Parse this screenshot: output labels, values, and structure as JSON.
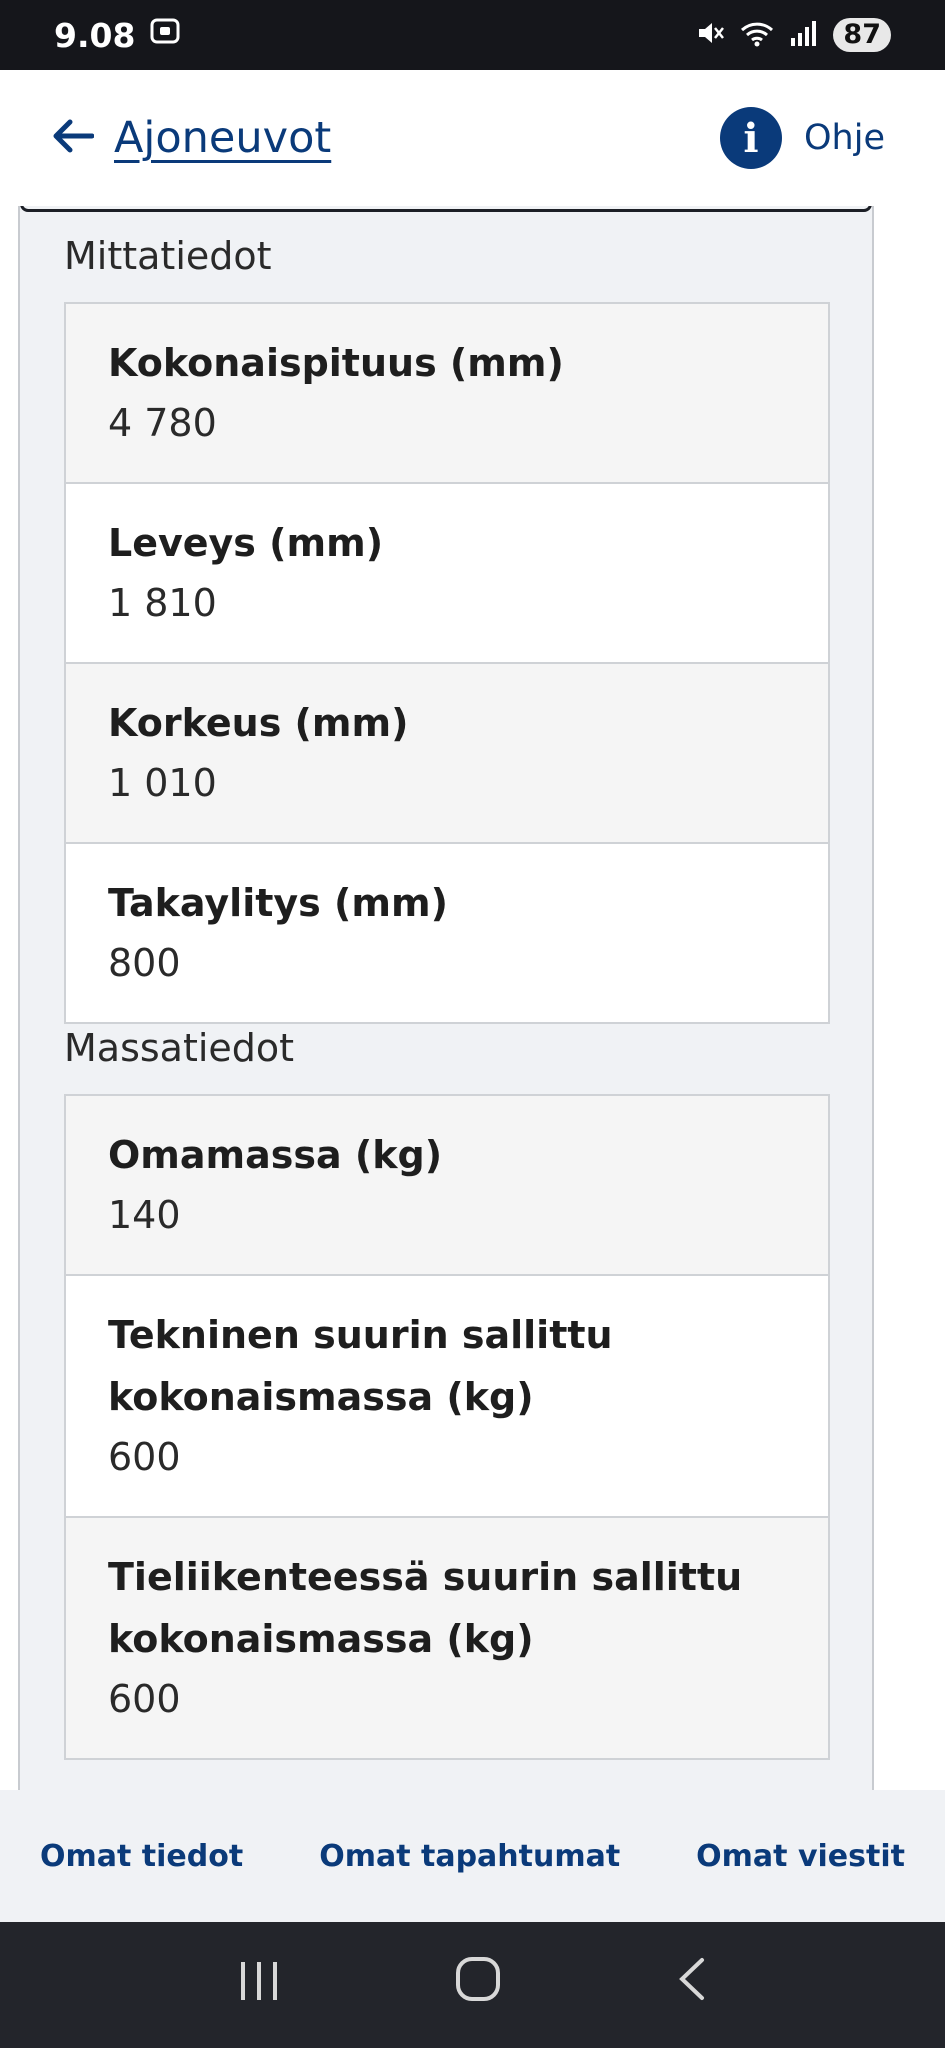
{
  "status_bar": {
    "time": "9.08",
    "battery": "87"
  },
  "header": {
    "back_label": "Ajoneuvot",
    "help_label": "Ohje"
  },
  "sections": {
    "dimensions": {
      "title": "Mittatiedot",
      "rows": [
        {
          "label": "Kokonaispituus (mm)",
          "value": "4 780"
        },
        {
          "label": "Leveys (mm)",
          "value": "1 810"
        },
        {
          "label": "Korkeus (mm)",
          "value": "1 010"
        },
        {
          "label": "Takaylitys (mm)",
          "value": "800"
        }
      ]
    },
    "mass": {
      "title": "Massatiedot",
      "rows": [
        {
          "label": "Omamassa (kg)",
          "value": "140"
        },
        {
          "label": "Tekninen suurin sallittu kokonaismassa (kg)",
          "value": "600"
        },
        {
          "label": "Tieliikenteessä suurin sallittu kokonaismassa (kg)",
          "value": "600"
        }
      ]
    }
  },
  "bottom_nav": {
    "item1": "Omat tiedot",
    "item2": "Omat tapahtumat",
    "item3": "Omat viestit"
  },
  "colors": {
    "brand": "#0a3a7a",
    "panel_bg": "#f0f2f5"
  },
  "icons": {
    "back": "arrow-left-icon",
    "help": "info-icon",
    "mute": "mute-icon",
    "wifi": "wifi-icon",
    "signal": "signal-icon"
  }
}
